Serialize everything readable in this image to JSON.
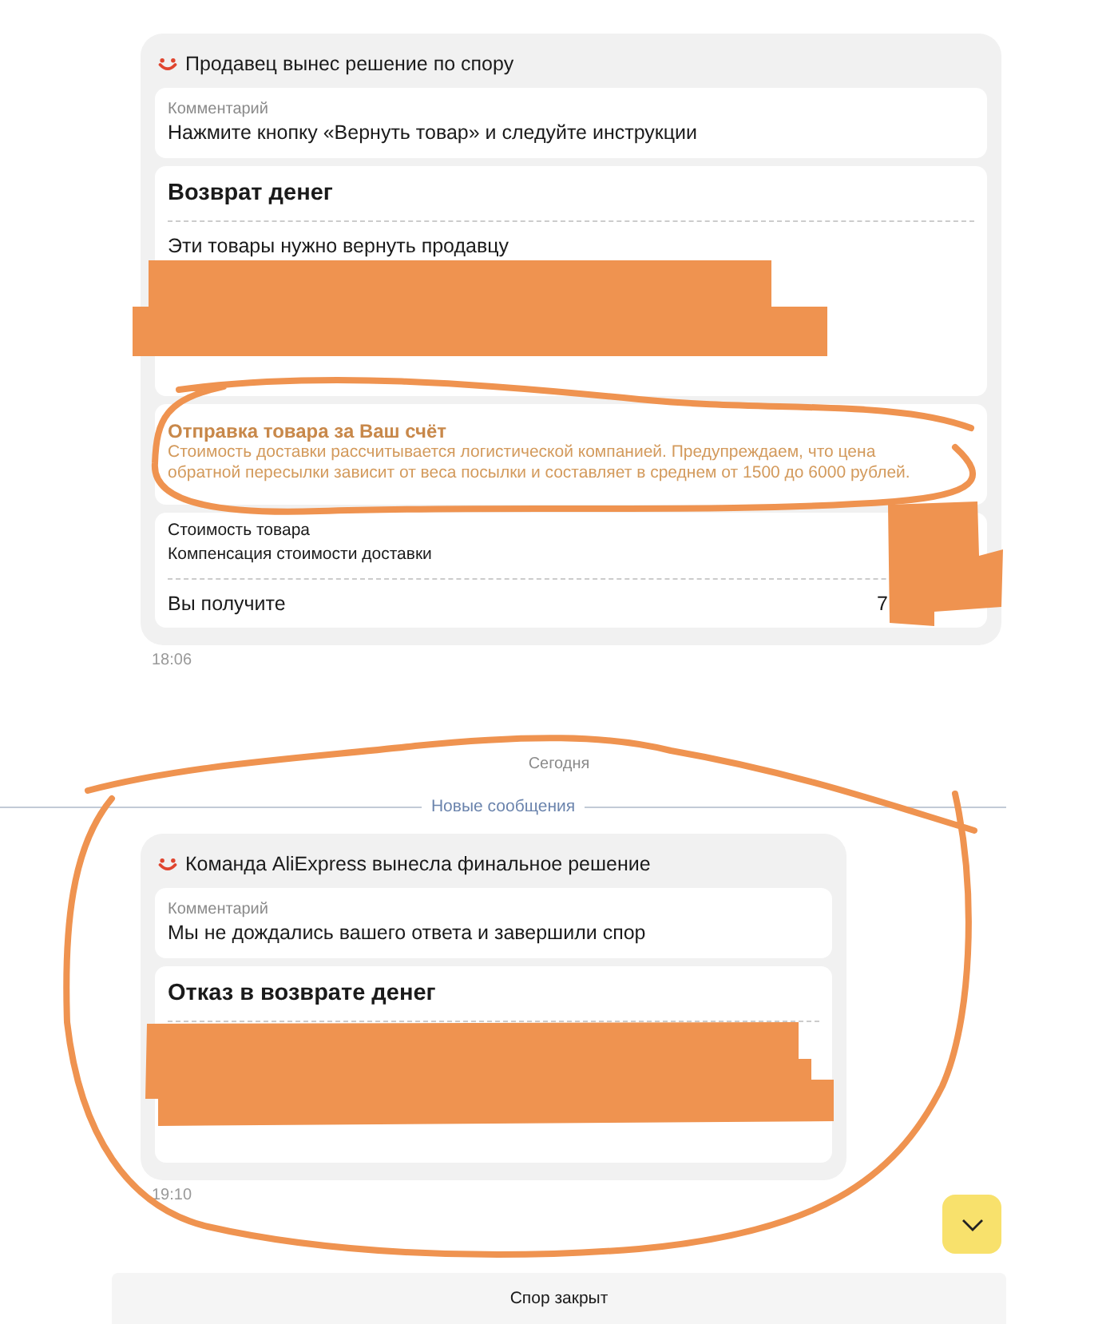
{
  "feed": [
    {
      "kind": "message",
      "header": "Продавец вынес решение по спору",
      "comment_label": "Комментарий",
      "comment": "Нажмите кнопку «Вернуть товар» и следуйте инструкции",
      "decision_title": "Возврат денег",
      "items_heading": "Эти товары нужно вернуть продавцу",
      "notice": {
        "title": "Отправка товара за Ваш счёт",
        "text": "Стоимость доставки рассчитывается логистической компанией. Предупреждаем, что цена обратной пересылки зависит от веса посылки и составляет в среднем от 1500 до 6000 рублей."
      },
      "summary": [
        {
          "label": "Стоимость товара"
        },
        {
          "label": "Компенсация стоимости доставки"
        }
      ],
      "total": {
        "label": "Вы получите",
        "value": "7"
      },
      "time": "18:06"
    },
    {
      "kind": "date",
      "text": "Сегодня"
    },
    {
      "kind": "new_divider",
      "text": "Новые сообщения"
    },
    {
      "kind": "message",
      "header": "Команда AliExpress вынесла финальное решение",
      "comment_label": "Комментарий",
      "comment": "Мы не дождались вашего ответа и завершили спор",
      "decision_title": "Отказ в возврате денег",
      "time": "19:10"
    }
  ],
  "status_bar": "Спор закрыт"
}
